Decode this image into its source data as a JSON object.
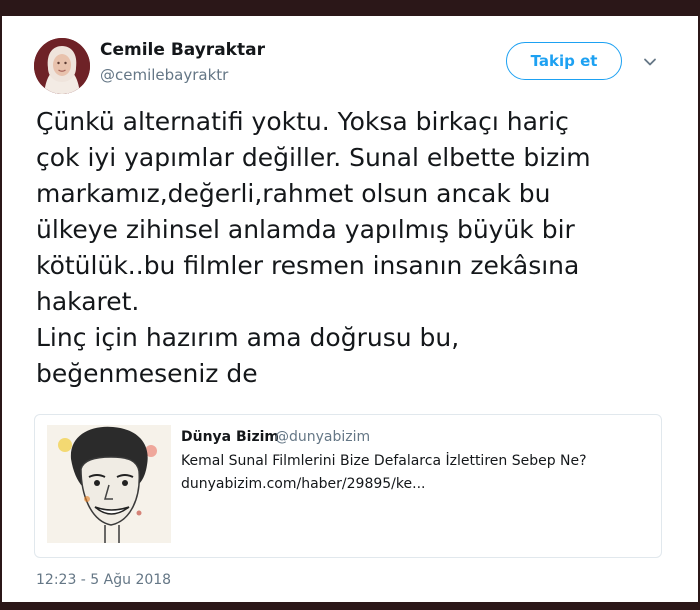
{
  "author": {
    "name": "Cemile Bayraktar",
    "handle": "@cemilebayraktr"
  },
  "follow_button": {
    "label": "Takip et"
  },
  "menu": {
    "icon": "chevron-down-icon"
  },
  "tweet": {
    "lines": [
      "Çünkü alternatifi yoktu. Yoksa birkaçı hariç",
      "çok iyi yapımlar değiller. Sunal elbette bizim",
      "markamız,değerli,rahmet olsun ancak bu",
      "ülkeye zihinsel anlamda yapılmış büyük bir",
      "kötülük..bu filmler resmen insanın zekâsına",
      "hakaret.",
      "Linç için hazırım ama doğrusu bu,",
      "beğenmeseniz de"
    ]
  },
  "quoted_card": {
    "name": "Dünya Bizim",
    "handle": "@dunyabizim",
    "title": "Kemal Sunal Filmlerini Bize Defalarca İzlettiren Sebep Ne?",
    "url": "dunyabizim.com/haber/29895/ke..."
  },
  "timestamp": "12:23 - 5 Ağu 2018",
  "colors": {
    "accent": "#1da1f2",
    "text": "#14171a",
    "secondary": "#657786",
    "frame": "#2b1718"
  }
}
